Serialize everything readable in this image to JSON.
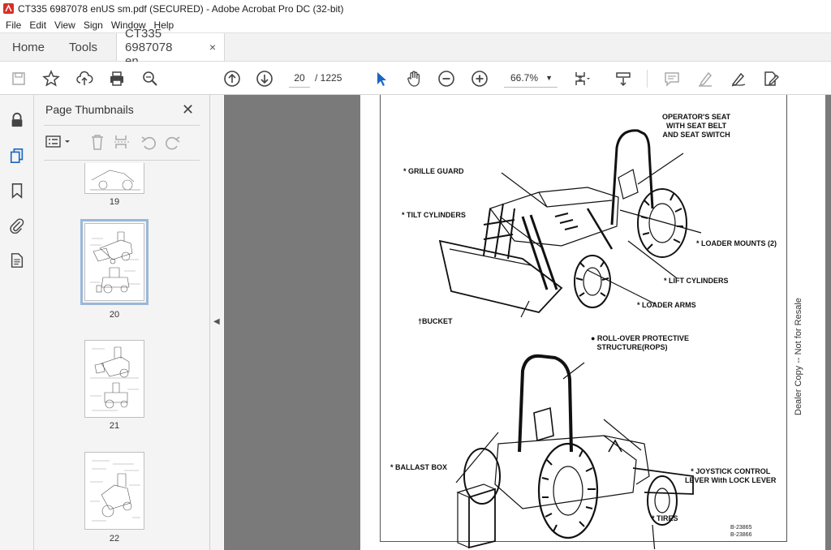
{
  "window": {
    "title": "CT335 6987078 enUS sm.pdf (SECURED) - Adobe Acrobat Pro DC (32-bit)"
  },
  "menu": [
    "File",
    "Edit",
    "View",
    "Sign",
    "Window",
    "Help"
  ],
  "tabs": {
    "home": "Home",
    "tools": "Tools",
    "doc": "CT335 6987078 en...",
    "doc_close": "×"
  },
  "toolbar": {
    "page_current": "20",
    "page_total": "/  1225",
    "zoom": "66.7%"
  },
  "thumbnail_panel": {
    "title": "Page Thumbnails",
    "close": "✕",
    "pages": [
      "19",
      "20",
      "21",
      "22"
    ],
    "selected": "20"
  },
  "document": {
    "labels": {
      "operator_seat": "OPERATOR'S SEAT\nWITH SEAT BELT\nAND SEAT SWITCH",
      "grille_guard": "* GRILLE GUARD",
      "tilt_cylinders": "* TILT CYLINDERS",
      "loader_mounts": "* LOADER MOUNTS (2)",
      "lift_cylinders": "* LIFT CYLINDERS",
      "loader_arms": "* LOADER ARMS",
      "bucket": "†BUCKET",
      "rops": "● ROLL-OVER PROTECTIVE\n   STRUCTURE(ROPS)",
      "ballast_box": "* BALLAST BOX",
      "joystick": "* JOYSTICK CONTROL\nLEVER With LOCK LEVER",
      "tires": "* TIRES",
      "codes": "B-23865\nB-23866"
    },
    "side_text": "Dealer Copy -- Not for Resale"
  },
  "colors": {
    "accent_red": "#d4302b",
    "viewer_bg": "#7a7a7a",
    "selection": "#9ab8d9"
  }
}
